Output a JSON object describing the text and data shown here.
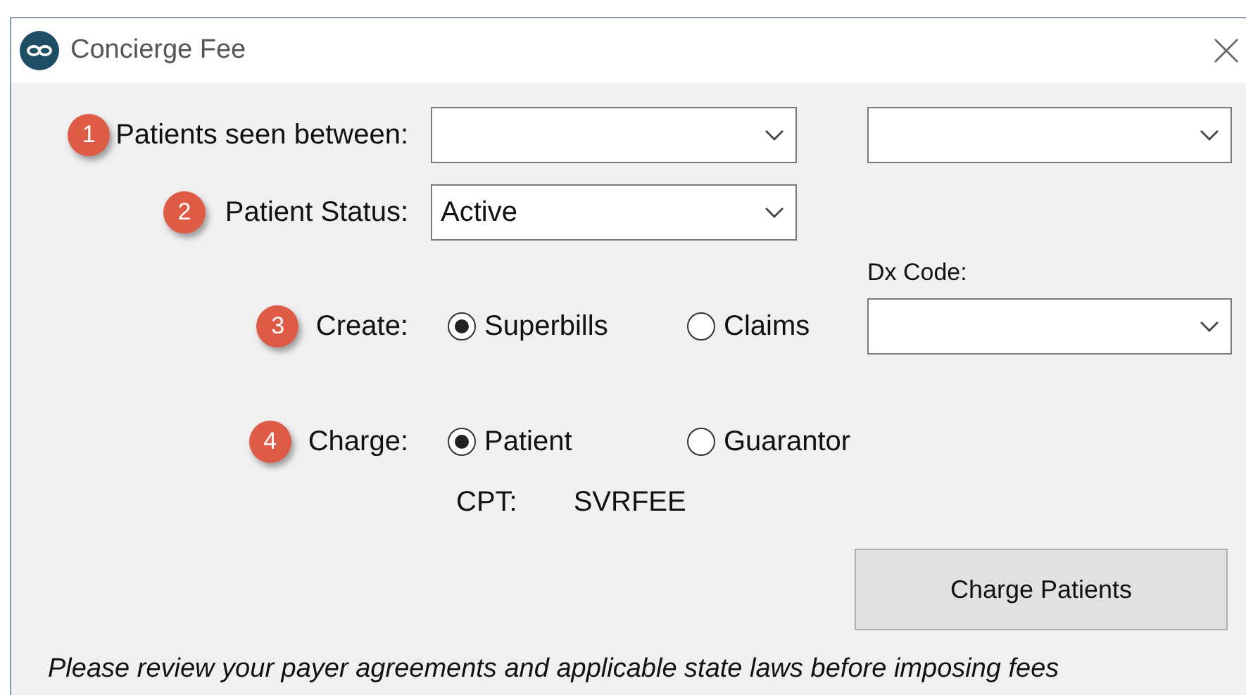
{
  "window": {
    "title": "Concierge Fee"
  },
  "date_range": {
    "step": "1",
    "label": "Patients seen between:"
  },
  "patient_status": {
    "step": "2",
    "label": "Patient Status:",
    "value": "Active"
  },
  "dx_code": {
    "label": "Dx Code:"
  },
  "create": {
    "step": "3",
    "label": "Create:",
    "options": [
      {
        "label": "Superbills",
        "selected": true
      },
      {
        "label": "Claims",
        "selected": false
      }
    ]
  },
  "charge": {
    "step": "4",
    "label": "Charge:",
    "options": [
      {
        "label": "Patient",
        "selected": true
      },
      {
        "label": "Guarantor",
        "selected": false
      }
    ]
  },
  "cpt": {
    "label": "CPT:",
    "value": "SVRFEE"
  },
  "button": "Charge Patients",
  "notice": "Please review your payer agreements and applicable state laws before imposing fees"
}
